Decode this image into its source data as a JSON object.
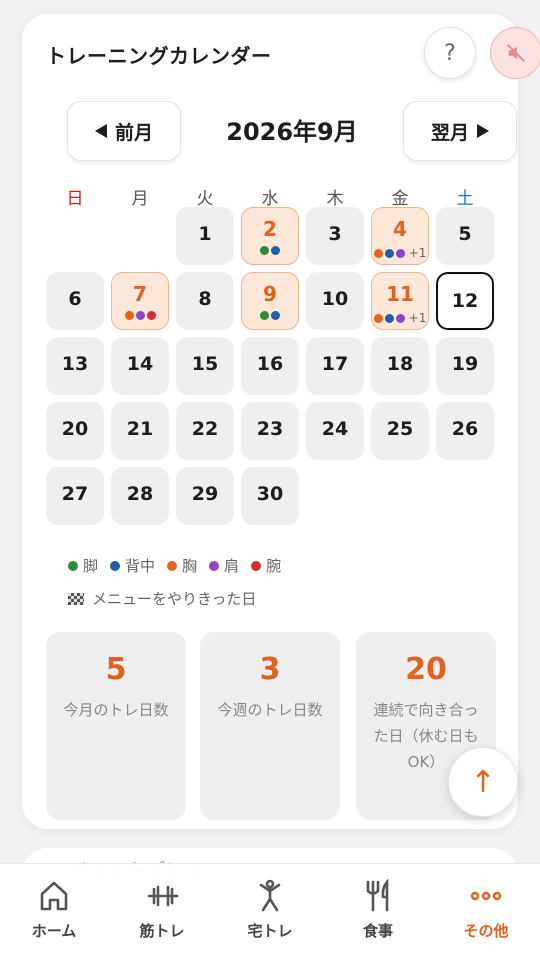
{
  "calendar": {
    "title": "トレーニングカレンダー",
    "help_icon": "?",
    "mute_icon": "speaker-muted-icon",
    "prev_label": "前月",
    "next_label": "翌月",
    "month_label": "2026年9月",
    "weekdays": [
      "日",
      "月",
      "火",
      "水",
      "木",
      "金",
      "土"
    ],
    "weekday_colors": [
      "#d11f1f",
      "#555555",
      "#555555",
      "#555555",
      "#555555",
      "#555555",
      "#1f6fd1"
    ],
    "today": 12,
    "days": [
      {
        "day": "1",
        "dots": []
      },
      {
        "day": "2",
        "dots": [
          "#2e8b3a",
          "#1f5fa8"
        ],
        "more": ""
      },
      {
        "day": "3",
        "dots": []
      },
      {
        "day": "4",
        "dots": [
          "#e8621b",
          "#1f5fa8",
          "#8e44c4"
        ],
        "more": "+1"
      },
      {
        "day": "5",
        "dots": []
      },
      {
        "day": "6",
        "dots": []
      },
      {
        "day": "7",
        "dots": [
          "#e8621b",
          "#8e44c4",
          "#d12f2f"
        ],
        "more": ""
      },
      {
        "day": "8",
        "dots": []
      },
      {
        "day": "9",
        "dots": [
          "#2e8b3a",
          "#1f5fa8"
        ],
        "more": ""
      },
      {
        "day": "10",
        "dots": []
      },
      {
        "day": "11",
        "dots": [
          "#e8621b",
          "#1f5fa8",
          "#8e44c4"
        ],
        "more": "+1"
      },
      {
        "day": "12",
        "dots": []
      },
      {
        "day": "13",
        "dots": []
      },
      {
        "day": "14",
        "dots": []
      },
      {
        "day": "15",
        "dots": []
      },
      {
        "day": "16",
        "dots": []
      },
      {
        "day": "17",
        "dots": []
      },
      {
        "day": "18",
        "dots": []
      },
      {
        "day": "19",
        "dots": []
      },
      {
        "day": "20",
        "dots": []
      },
      {
        "day": "21",
        "dots": []
      },
      {
        "day": "22",
        "dots": []
      },
      {
        "day": "23",
        "dots": []
      },
      {
        "day": "24",
        "dots": []
      },
      {
        "day": "25",
        "dots": []
      },
      {
        "day": "26",
        "dots": []
      },
      {
        "day": "27",
        "dots": []
      },
      {
        "day": "28",
        "dots": []
      },
      {
        "day": "29",
        "dots": []
      },
      {
        "day": "30",
        "dots": []
      }
    ],
    "first_weekday": 2
  },
  "legend": [
    {
      "label": "脚",
      "color": "#2e8b3a"
    },
    {
      "label": "背中",
      "color": "#1f5fa8"
    },
    {
      "label": "胸",
      "color": "#e8621b"
    },
    {
      "label": "肩",
      "color": "#8e44c4"
    },
    {
      "label": "腕",
      "color": "#d12f2f"
    }
  ],
  "complete_note": "メニューをやりきった日",
  "stats": [
    {
      "value": "5",
      "label": "今月のトレ日数"
    },
    {
      "value": "3",
      "label": "今週のトレ日数"
    },
    {
      "value": "20",
      "label": "連続で向き合った日（休む日もOK）"
    }
  ],
  "fab_icon": "↑",
  "next_card_text": "チェストプレス",
  "tabs": [
    {
      "label": "ホーム",
      "icon": "home-icon",
      "active": false
    },
    {
      "label": "筋トレ",
      "icon": "dumbbell-icon",
      "active": false
    },
    {
      "label": "宅トレ",
      "icon": "stretch-person-icon",
      "active": false
    },
    {
      "label": "食事",
      "icon": "fork-knife-icon",
      "active": false
    },
    {
      "label": "その他",
      "icon": "more-dots-icon",
      "active": true
    }
  ],
  "accent_color": "#e2611d"
}
